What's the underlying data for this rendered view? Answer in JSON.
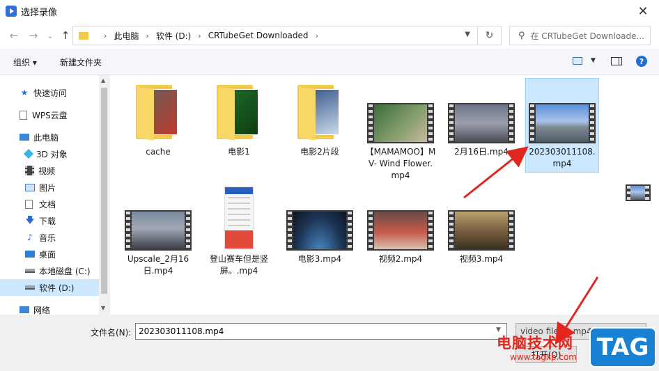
{
  "window": {
    "title": "选择录像",
    "close_glyph": "✕"
  },
  "nav": {
    "back": "←",
    "forward": "→",
    "recent": "⌄",
    "up": "↑",
    "breadcrumbs": [
      "此电脑",
      "软件 (D:)",
      "CRTubeGet Downloaded"
    ],
    "refresh": "↻",
    "search_placeholder": "在 CRTubeGet Downloade..."
  },
  "toolbar": {
    "organize": "组织 ▾",
    "new_folder": "新建文件夹",
    "help": "?"
  },
  "sidebar": {
    "items": [
      {
        "label": "快速访问",
        "icon": "star-icon"
      },
      {
        "label": "WPS云盘",
        "icon": "document-icon"
      },
      {
        "label": "此电脑",
        "icon": "computer-icon"
      },
      {
        "label": "3D 对象",
        "icon": "cube-icon"
      },
      {
        "label": "视频",
        "icon": "film-icon"
      },
      {
        "label": "图片",
        "icon": "picture-icon"
      },
      {
        "label": "文档",
        "icon": "document-icon"
      },
      {
        "label": "下载",
        "icon": "download-icon"
      },
      {
        "label": "音乐",
        "icon": "music-icon"
      },
      {
        "label": "桌面",
        "icon": "desktop-icon"
      },
      {
        "label": "本地磁盘 (C:)",
        "icon": "drive-icon"
      },
      {
        "label": "软件 (D:)",
        "icon": "drive-icon",
        "selected": true
      },
      {
        "label": "网络",
        "icon": "network-icon"
      }
    ]
  },
  "files": [
    {
      "name": "cache",
      "kind": "folder"
    },
    {
      "name": "电影1",
      "kind": "folder"
    },
    {
      "name": "电影2片段",
      "kind": "folder"
    },
    {
      "name": "【MAMAMOO】MV- Wind Flower.mp4",
      "kind": "video"
    },
    {
      "name": "2月16日.mp4",
      "kind": "video"
    },
    {
      "name": "202303011108.mp4",
      "kind": "video",
      "selected": true
    },
    {
      "name": "Upscale_2月16日.mp4",
      "kind": "video"
    },
    {
      "name": "登山赛车但是竖屏。.mp4",
      "kind": "phone"
    },
    {
      "name": "电影3.mp4",
      "kind": "video"
    },
    {
      "name": "视频2.mp4",
      "kind": "video"
    },
    {
      "name": "视频3.mp4",
      "kind": "video"
    }
  ],
  "bottom": {
    "filename_label": "文件名(N):",
    "filename_value": "202303011108.mp4",
    "filetype_value": "video files(*.mp4 *.ts *.wvd *.",
    "open_label": "打开(O)"
  },
  "watermark": {
    "text": "电脑技术网",
    "url": "www.tagxp.com",
    "tag": "TAG"
  },
  "colors": {
    "selection": "#cce8ff",
    "accent": "#2f6fd8",
    "annotation": "#e0261d"
  }
}
